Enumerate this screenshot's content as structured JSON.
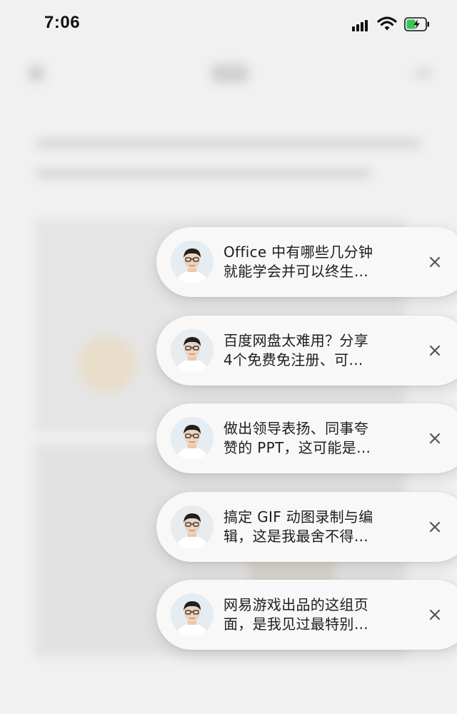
{
  "status_bar": {
    "time": "7:06"
  },
  "notifications": [
    {
      "line1": "Office 中有哪些几分钟",
      "line2": "就能学会并可以终生…"
    },
    {
      "line1": "百度网盘太难用？分享",
      "line2": "4个免费免注册、可…"
    },
    {
      "line1": "做出领导表扬、同事夸",
      "line2": "赞的 PPT，这可能是…"
    },
    {
      "line1": "搞定 GIF 动图录制与编",
      "line2": "辑，这是我最舍不得…"
    },
    {
      "line1": "网易游戏出品的这组页",
      "line2": "面，是我见过最特别…"
    }
  ],
  "colors": {
    "battery_fill": "#34c759",
    "background": "#f1f1f1"
  },
  "icons": [
    "signal-icon",
    "wifi-icon",
    "battery-icon",
    "avatar",
    "close-icon"
  ]
}
